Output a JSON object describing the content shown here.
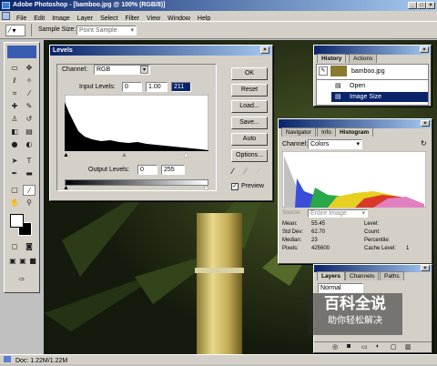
{
  "app": {
    "title": "Adobe Photoshop - [bamboo.jpg @ 100% (RGB/8)]",
    "menu": [
      "File",
      "Edit",
      "Image",
      "Layer",
      "Select",
      "Filter",
      "View",
      "Window",
      "Help"
    ]
  },
  "options_bar": {
    "sample_size_label": "Sample Size:",
    "sample_size_value": "Point Sample"
  },
  "levels": {
    "title": "Levels",
    "channel_label": "Channel:",
    "channel_value": "RGB",
    "input_label": "Input Levels:",
    "input_black": "0",
    "input_gamma": "1.00",
    "input_white": "211",
    "output_label": "Output Levels:",
    "output_black": "0",
    "output_white": "255",
    "buttons": {
      "ok": "OK",
      "reset": "Reset",
      "load": "Load...",
      "save": "Save...",
      "auto": "Auto",
      "options": "Options..."
    },
    "preview_label": "Preview",
    "preview_checked": true
  },
  "history": {
    "tabs": [
      "History",
      "Actions"
    ],
    "snapshot": "bamboo.jpg",
    "items": [
      "Open",
      "Image Size"
    ],
    "selected_index": 1
  },
  "navigator": {
    "tabs": [
      "Navigator",
      "Info",
      "Histogram"
    ],
    "channel_label": "Channel:",
    "channel_value": "Colors",
    "source_label": "Source:",
    "source_value": "Entire Image",
    "stats": {
      "mean_label": "Mean:",
      "mean": "55.45",
      "stddev_label": "Std Dev:",
      "stddev": "62.70",
      "median_label": "Median:",
      "median": "23",
      "pixels_label": "Pixels:",
      "pixels": "425600",
      "level_label": "Level:",
      "count_label": "Count:",
      "percentile_label": "Percentile:",
      "cache_label": "Cache Level:",
      "cache": "1"
    }
  },
  "layers": {
    "tabs": [
      "Layers",
      "Channels",
      "Paths"
    ],
    "blend_mode": "Normal"
  },
  "watermark": {
    "line1": "百科全说",
    "line2": "助你轻松解决"
  },
  "status": {
    "doc": "Doc: 1.22M/1.22M"
  }
}
